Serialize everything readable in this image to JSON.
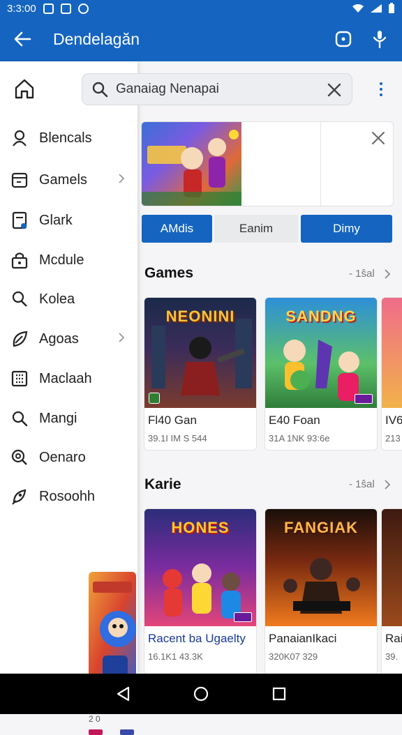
{
  "status_bar": {
    "time": "3:3:00"
  },
  "app_bar": {
    "title": "Dendelagăn"
  },
  "search": {
    "value": "Ganaiag Nenapai"
  },
  "drawer": {
    "items": [
      {
        "label": "Blencals",
        "icon": "people-icon",
        "chevron": false
      },
      {
        "label": "Gamels",
        "icon": "folder-icon",
        "chevron": true
      },
      {
        "label": "Glark",
        "icon": "document-icon",
        "chevron": false
      },
      {
        "label": "Mcdule",
        "icon": "lock-icon",
        "chevron": false
      },
      {
        "label": "Kolea",
        "icon": "person-search-icon",
        "chevron": false
      },
      {
        "label": "Agoas",
        "icon": "leaf-icon",
        "chevron": true
      },
      {
        "label": "Maclaah",
        "icon": "grid-icon",
        "chevron": false
      },
      {
        "label": "Mangi",
        "icon": "search-icon",
        "chevron": false
      },
      {
        "label": "Oenaro",
        "icon": "zoom-icon",
        "chevron": false
      },
      {
        "label": "Rosoohh",
        "icon": "rocket-icon",
        "chevron": false
      }
    ],
    "peek_label": "2 0"
  },
  "segments": [
    "AMdis",
    "Eanim",
    "Dimy"
  ],
  "sections": [
    {
      "title": "Games",
      "more": "- 1ŝal",
      "cards": [
        {
          "logo": "NEONINI",
          "name": "Fl40 Gan",
          "meta": "39.1I IM S 544"
        },
        {
          "logo": "SANDNG",
          "name": "E40 Foan",
          "meta": "31A 1NK 93:6e"
        },
        {
          "logo": "",
          "name": "IV6",
          "meta": "213"
        }
      ]
    },
    {
      "title": "Karie",
      "more": "- 1ŝal",
      "cards": [
        {
          "logo": "HONES",
          "name": "Racent ba Ugaelty",
          "meta": "16.1K1 43.3K"
        },
        {
          "logo": "FANGIAK",
          "name": "PanaianIkaci",
          "meta": "320K07 329"
        },
        {
          "logo": "",
          "name": "Rai",
          "meta": "39."
        }
      ]
    }
  ]
}
